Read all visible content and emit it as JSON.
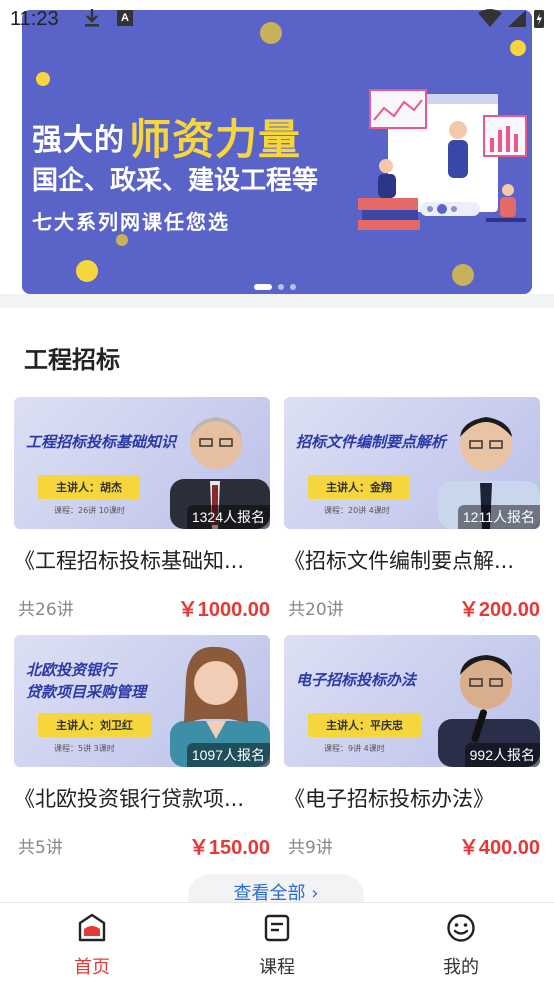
{
  "status_bar": {
    "time": "11:23"
  },
  "banner": {
    "line1_prefix": "强大的",
    "line1_highlight": "师资力量",
    "line2": "国企、政采、建设工程等",
    "line3": "七大系列网课任您选"
  },
  "section": {
    "title": "工程招标"
  },
  "courses": [
    {
      "thumb_title": "工程招标投标基础知识",
      "lecturer": "主讲人：胡杰",
      "meta": "课程：26讲    10课时",
      "enrolled": "1324人报名",
      "name": "《工程招标投标基础知...",
      "lessons": "共26讲",
      "price": "￥1000.00"
    },
    {
      "thumb_title": "招标文件编制要点解析",
      "lecturer": "主讲人：金翔",
      "meta": "课程：20讲    4课时",
      "enrolled": "1211人报名",
      "name": "《招标文件编制要点解...",
      "lessons": "共20讲",
      "price": "￥200.00"
    },
    {
      "thumb_title": "北欧投资银行\n贷款项目采购管理",
      "lecturer": "主讲人：刘卫红",
      "meta": "课程：5讲    3课时",
      "enrolled": "1097人报名",
      "name": "《北欧投资银行贷款项...",
      "lessons": "共5讲",
      "price": "￥150.00"
    },
    {
      "thumb_title": "电子招标投标办法",
      "lecturer": "主讲人：平庆忠",
      "meta": "课程：9讲    4课时",
      "enrolled": "992人报名",
      "name": "《电子招标投标办法》",
      "lessons": "共9讲",
      "price": "￥400.00"
    }
  ],
  "more_button": "查看全部 ›",
  "tabs": [
    {
      "label": "首页",
      "icon": "home-icon",
      "active": true
    },
    {
      "label": "课程",
      "icon": "book-icon",
      "active": false
    },
    {
      "label": "我的",
      "icon": "smiley-icon",
      "active": false
    }
  ],
  "colors": {
    "accent": "#e53935",
    "banner_bg": "#5a63c8",
    "highlight": "#f5d63d",
    "link": "#2d6ccf"
  }
}
